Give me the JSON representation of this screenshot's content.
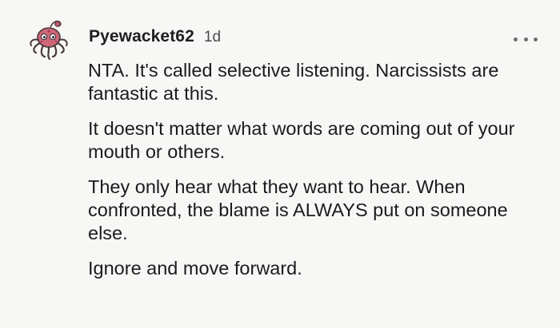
{
  "comment": {
    "username": "Pyewacket62",
    "age": "1d",
    "paragraphs": [
      "NTA. It's called selective listening. Narcissists are fantastic at this.",
      "It doesn't matter what words are coming out of your mouth or others.",
      "They only hear what they want to hear. When confronted, the blame is ALWAYS put on someone else.",
      "Ignore and move forward."
    ]
  },
  "icons": {
    "avatar": "octopus-avatar-icon",
    "more": "more-options-icon"
  },
  "colors": {
    "background": "#f7f7f6",
    "text": "#1b1b1b",
    "meta": "#4a4a4a",
    "avatar_accent": "#c7566b"
  }
}
